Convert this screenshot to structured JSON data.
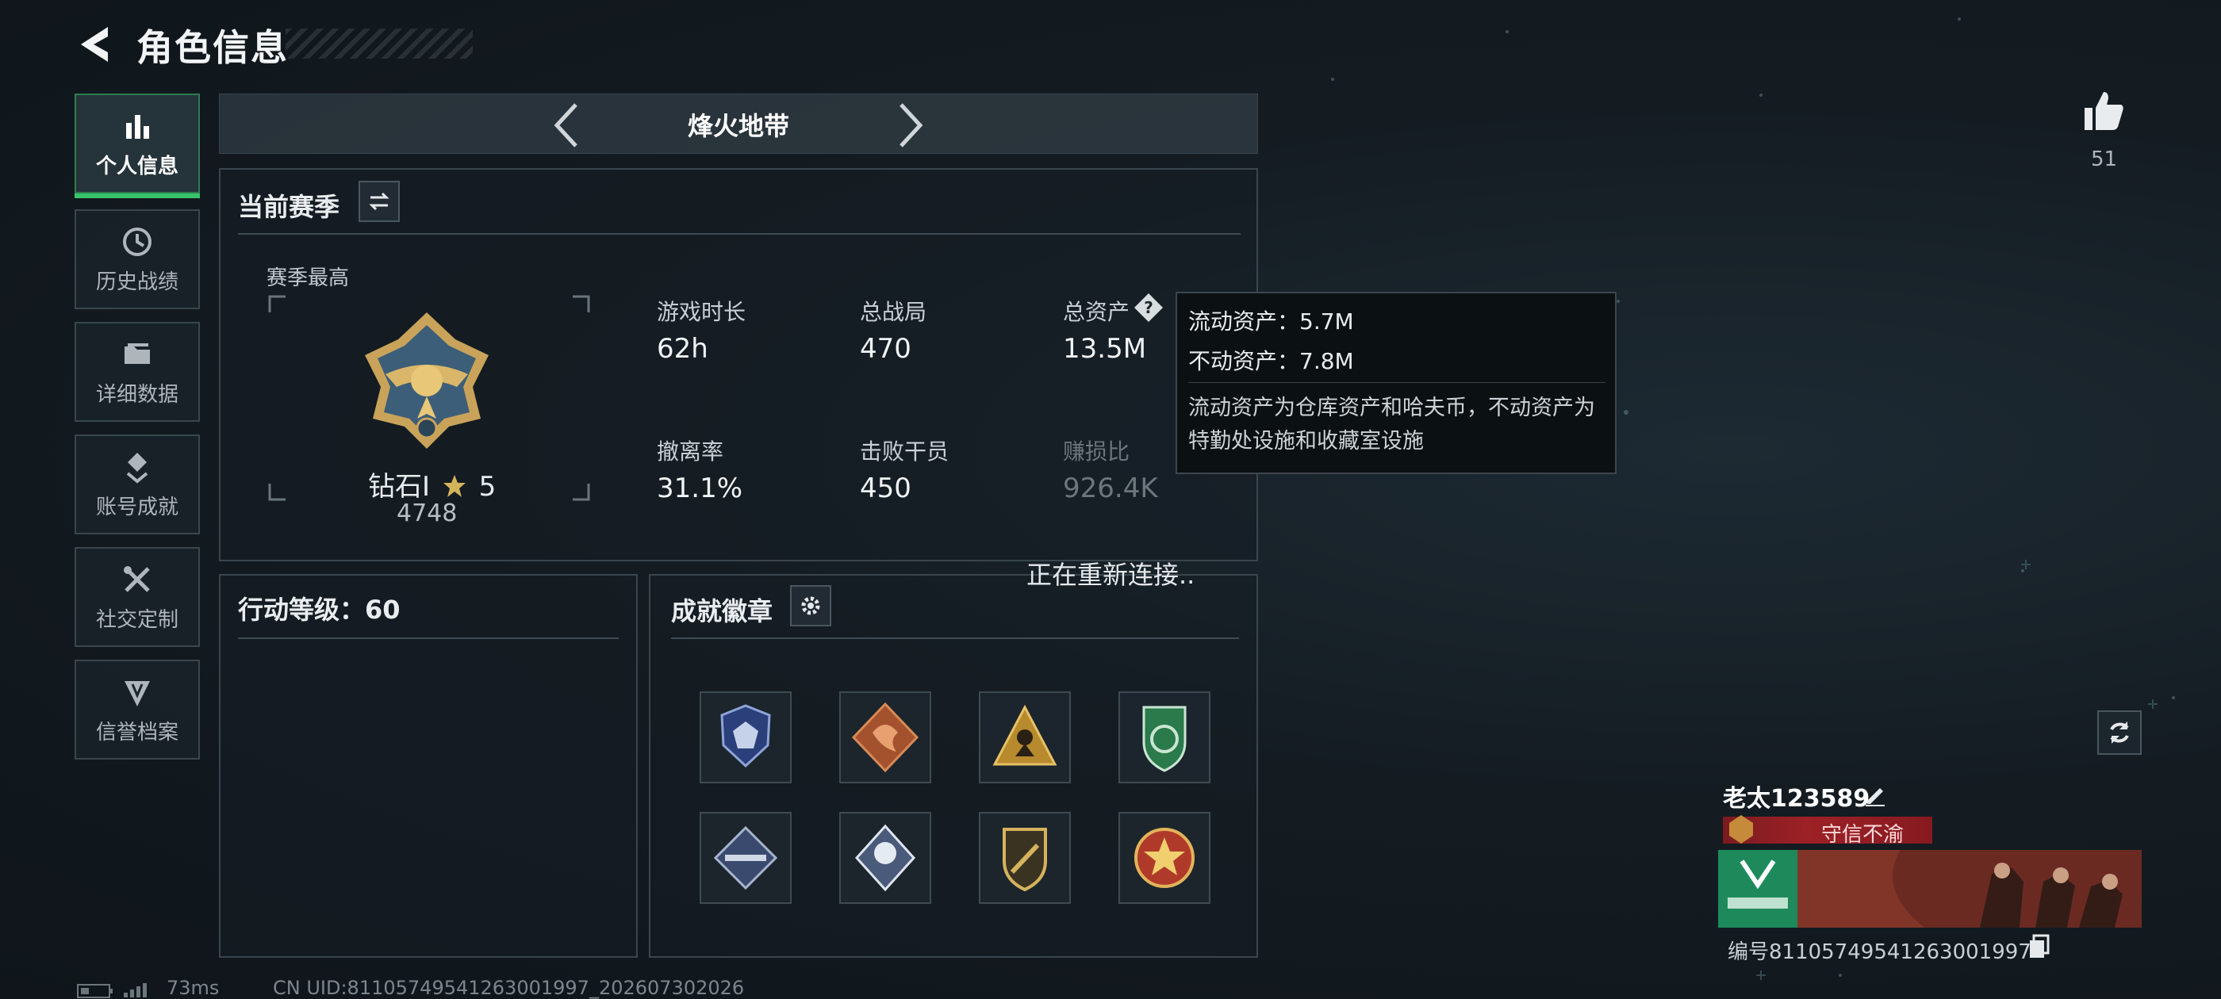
{
  "header": {
    "title": "角色信息"
  },
  "nav": [
    {
      "label": "个人信息",
      "icon": "bar-chart-icon",
      "active": true
    },
    {
      "label": "历史战绩",
      "icon": "history-icon"
    },
    {
      "label": "详细数据",
      "icon": "folder-icon"
    },
    {
      "label": "账号成就",
      "icon": "achievement-icon"
    },
    {
      "label": "社交定制",
      "icon": "tools-icon"
    },
    {
      "label": "信誉档案",
      "icon": "shield-icon"
    }
  ],
  "mode": {
    "title": "烽火地带"
  },
  "season": {
    "title": "当前赛季",
    "best_label": "赛季最高",
    "rank_name": "钻石Ⅰ",
    "rank_stars": "5",
    "rank_score": "4748",
    "stats": [
      {
        "label": "游戏时长",
        "value": "62h"
      },
      {
        "label": "总战局",
        "value": "470"
      },
      {
        "label": "总资产",
        "value": "13.5M"
      },
      {
        "label": "撤离率",
        "value": "31.1%"
      },
      {
        "label": "击败干员",
        "value": "450"
      },
      {
        "label": "赚损比",
        "value": "926.4K"
      }
    ]
  },
  "tooltip": {
    "line1": "流动资产：5.7M",
    "line2": "不动资产：7.8M",
    "desc": "流动资产为仓库资产和哈夫币，不动资产为特勤处设施和收藏室设施"
  },
  "status": {
    "reconnecting": "正在重新连接.."
  },
  "action": {
    "title": "行动等级：60"
  },
  "badges": {
    "title": "成就徽章",
    "items": [
      "navy-shield-badge",
      "bronze-dragon-badge",
      "gold-soldier-badge",
      "green-shield-badge",
      "rifle-badge",
      "silver-diamond-badge",
      "gold-knife-badge",
      "red-star-badge"
    ]
  },
  "profile": {
    "likes": "51",
    "name": "老太123589",
    "title": "守信不渝",
    "id": "编号8110574954126300199​7"
  },
  "footer": {
    "ping": "73ms",
    "uid": "CN UID:811057495412630019​97_202607302026"
  },
  "colors": {
    "accent_green": "#37c46a",
    "title_red": "#9c2127",
    "tooltip_bg": "#0b1013"
  }
}
